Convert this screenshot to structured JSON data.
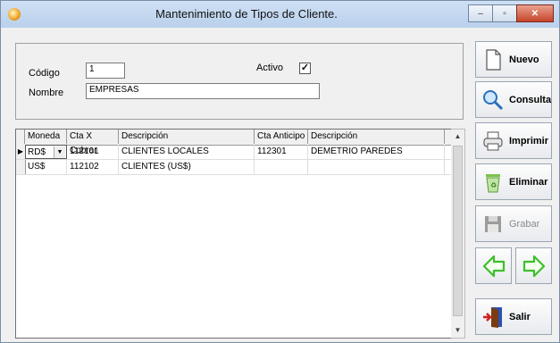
{
  "window": {
    "title": "Mantenimiento de Tipos de Cliente.",
    "controls": [
      "‒",
      "▫",
      "✕"
    ]
  },
  "form": {
    "codigo_label": "Código",
    "codigo_value": "1",
    "activo_label": "Activo",
    "activo_checked": true,
    "activo_mark": "✓",
    "nombre_label": "Nombre",
    "nombre_value": "EMPRESAS"
  },
  "grid": {
    "columns": [
      "Moneda",
      "Cta X Cobrar",
      "Descripción",
      "Cta Anticipo",
      "Descripción"
    ],
    "rows": [
      {
        "moneda": "RD$",
        "cta_cobrar": "112101",
        "descripcion": "CLIENTES LOCALES",
        "cta_anticipo": "112301",
        "descripcion2": "DEMETRIO PAREDES",
        "current": true
      },
      {
        "moneda": "US$",
        "cta_cobrar": "112102",
        "descripcion": "CLIENTES (US$)",
        "cta_anticipo": "",
        "descripcion2": "",
        "current": false
      }
    ],
    "current_marker": "▶",
    "dropdown_glyph": "▼",
    "scroll_up": "▲",
    "scroll_down": "▼"
  },
  "toolbar": {
    "nuevo": "Nuevo",
    "consulta": "Consulta",
    "imprimir": "Imprimir",
    "eliminar": "Eliminar",
    "grabar": "Grabar",
    "salir": "Salir",
    "grabar_enabled": false
  },
  "colors": {
    "nav_arrow": "#3cbf2b",
    "title_bar": "#c4d8f0"
  }
}
